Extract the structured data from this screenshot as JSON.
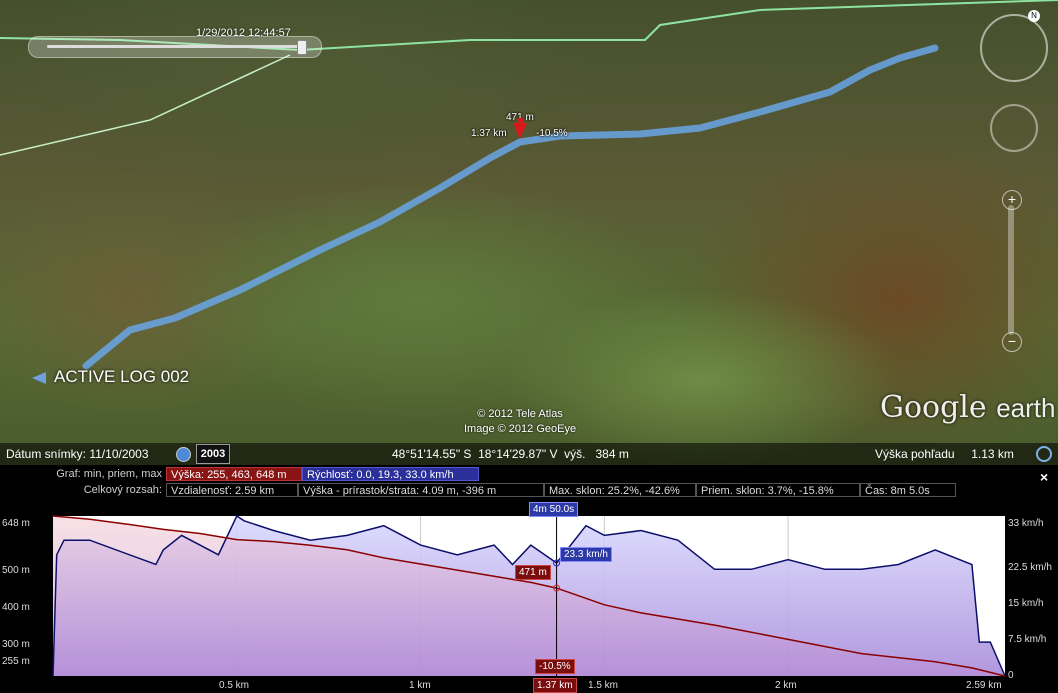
{
  "timeslider": {
    "label": "1/29/2012  12:44:57"
  },
  "map_marker": {
    "elevation": "471 m",
    "distance": "1.37 km",
    "slope": "-10.5%"
  },
  "active_log": {
    "label": "ACTIVE LOG 002"
  },
  "copyright": {
    "line1": "© 2012 Tele Atlas",
    "line2": "Image © 2012 GeoEye"
  },
  "logo": {
    "word1": "Google",
    "word2": "earth"
  },
  "status": {
    "imagery_date": "Dátum snímky: 11/10/2003",
    "year_button": "2003",
    "coords": "48°51'14.55\" S  18°14'29.87\" V  výš.   384 m",
    "eye_alt": "Výška pohľadu     1.13 km"
  },
  "panel": {
    "row1_label": "Graf: min, priem, max",
    "elev_stat": "Výška: 255, 463, 648 m",
    "speed_stat": "Rýchlosť: 0.0, 19.3, 33.0 km/h",
    "row2_label": "Celkový rozsah:",
    "distance": "Vzdialenosť: 2.59 km",
    "gain": "Výška - prírastok/strata: 4.09 m, -396 m",
    "max_slope": "Max. sklon: 25.2%, -42.6%",
    "avg_slope": "Priem. sklon: 3.7%, -15.8%",
    "time": "Čas: 8m 5.0s",
    "close_label": "×"
  },
  "profile": {
    "left_ticks": [
      "648 m",
      "500 m",
      "400 m",
      "300 m",
      "255 m"
    ],
    "right_ticks": [
      "33 km/h",
      "22.5 km/h",
      "15 km/h",
      "7.5 km/h",
      "0"
    ],
    "x_ticks": [
      "0.5 km",
      "1 km",
      "1.5 km",
      "2 km",
      "2.59 km"
    ],
    "cursor_time": "4m 50.0s",
    "cursor_speed": "23.3 km/h",
    "cursor_elev": "471 m",
    "cursor_slope": "-10.5%",
    "cursor_dist": "1.37 km"
  },
  "chart_data": {
    "type": "line",
    "x_unit": "km",
    "xlim": [
      0,
      2.59
    ],
    "series": [
      {
        "name": "Výška",
        "unit": "m",
        "ylim": [
          255,
          648
        ],
        "x": [
          0,
          0.1,
          0.2,
          0.3,
          0.4,
          0.5,
          0.6,
          0.7,
          0.8,
          0.9,
          1.0,
          1.1,
          1.2,
          1.3,
          1.37,
          1.5,
          1.6,
          1.8,
          2.0,
          2.2,
          2.4,
          2.5,
          2.59
        ],
        "y": [
          648,
          640,
          628,
          615,
          605,
          590,
          585,
          576,
          565,
          545,
          530,
          515,
          500,
          485,
          471,
          430,
          410,
          380,
          345,
          310,
          290,
          275,
          255
        ]
      },
      {
        "name": "Rýchlosť",
        "unit": "km/h",
        "ylim": [
          0,
          33
        ],
        "x": [
          0,
          0.01,
          0.03,
          0.1,
          0.28,
          0.3,
          0.35,
          0.4,
          0.45,
          0.5,
          0.52,
          0.6,
          0.7,
          0.8,
          0.9,
          1.0,
          1.1,
          1.2,
          1.25,
          1.3,
          1.37,
          1.45,
          1.5,
          1.6,
          1.7,
          1.8,
          1.9,
          2.0,
          2.1,
          2.2,
          2.3,
          2.4,
          2.5,
          2.52,
          2.55,
          2.59
        ],
        "y": [
          0,
          25,
          28,
          28,
          23,
          26,
          29,
          27,
          25,
          33,
          32,
          30,
          28,
          29,
          31,
          27,
          25,
          27,
          23,
          27,
          23.3,
          31,
          29,
          30,
          28,
          22,
          22,
          24,
          22,
          22,
          23,
          26,
          23,
          7,
          7,
          0
        ]
      }
    ]
  }
}
